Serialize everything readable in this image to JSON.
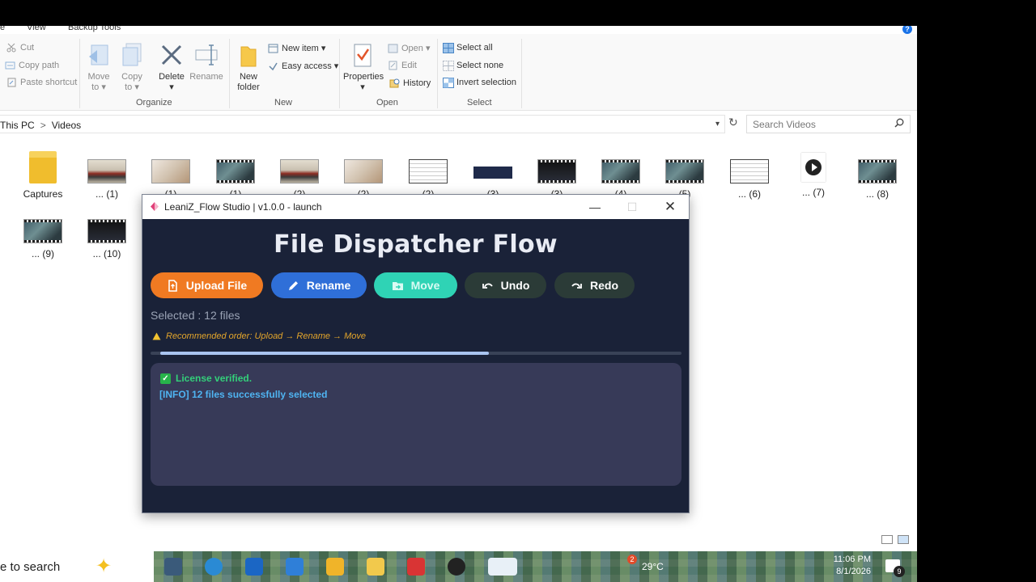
{
  "explorer": {
    "menu_tabs": [
      "e",
      "View",
      "Backup Tools"
    ],
    "ribbon": {
      "clipboard": {
        "cut": "Cut",
        "copy_path": "Copy path",
        "paste_shortcut": "Paste shortcut"
      },
      "organize": {
        "move_to": "Move\nto ▾",
        "copy_to": "Copy\nto ▾",
        "delete": "Delete\n▾",
        "rename": "Rename",
        "group_label": "Organize"
      },
      "new": {
        "new_folder": "New\nfolder",
        "new_item": "New item ▾",
        "easy_access": "Easy access ▾",
        "group_label": "New"
      },
      "open": {
        "properties": "Properties\n▾",
        "open": "Open ▾",
        "edit": "Edit",
        "history": "History",
        "group_label": "Open"
      },
      "select": {
        "select_all": "Select all",
        "select_none": "Select none",
        "invert_selection": "Invert selection",
        "group_label": "Select"
      }
    },
    "address": {
      "crumbs": [
        "This PC",
        "Videos"
      ],
      "separator": ">"
    },
    "search": {
      "placeholder": "Search Videos"
    },
    "files": [
      {
        "label": "Captures",
        "kind": "folder"
      },
      {
        "label": "... (1)",
        "kind": "bike"
      },
      {
        "label": "(1)",
        "kind": "cat"
      },
      {
        "label": "(1)",
        "kind": "film"
      },
      {
        "label": "(2)",
        "kind": "bike"
      },
      {
        "label": "(2)",
        "kind": "cat"
      },
      {
        "label": "(2)",
        "kind": "doc"
      },
      {
        "label": "(3)",
        "kind": "screen"
      },
      {
        "label": "(3)",
        "kind": "dark"
      },
      {
        "label": "(4)",
        "kind": "film"
      },
      {
        "label": "(5)",
        "kind": "film"
      },
      {
        "label": "... (6)",
        "kind": "doc"
      },
      {
        "label": "... (7)",
        "kind": "player"
      },
      {
        "label": "... (8)",
        "kind": "film"
      },
      {
        "label": "... (9)",
        "kind": "film"
      },
      {
        "label": "... (10)",
        "kind": "dark"
      }
    ]
  },
  "app": {
    "window_title": "LeaniZ_Flow Studio | v1.0.0 - launch",
    "heading": "File Dispatcher Flow",
    "buttons": {
      "upload": "Upload File",
      "rename": "Rename",
      "move": "Move",
      "undo": "Undo",
      "redo": "Redo"
    },
    "selected": "Selected : 12 files",
    "hint": "Recommended order: Upload → Rename → Move",
    "progress": 0.63,
    "log": [
      "License verified.",
      "[INFO] 12 files successfully selected"
    ]
  },
  "taskbar": {
    "search_text": "e to search",
    "weather": "29°C",
    "time": "11:06 PM",
    "date": "8/1/2026",
    "notification_count": "9",
    "badge": "2"
  },
  "colors": {
    "upload": "#f07a22",
    "rename": "#2f6fd8",
    "move": "#2fd3b5",
    "dark_button": "#2b3b37",
    "app_bg": "#1a2238",
    "log_bg": "#373a58"
  }
}
